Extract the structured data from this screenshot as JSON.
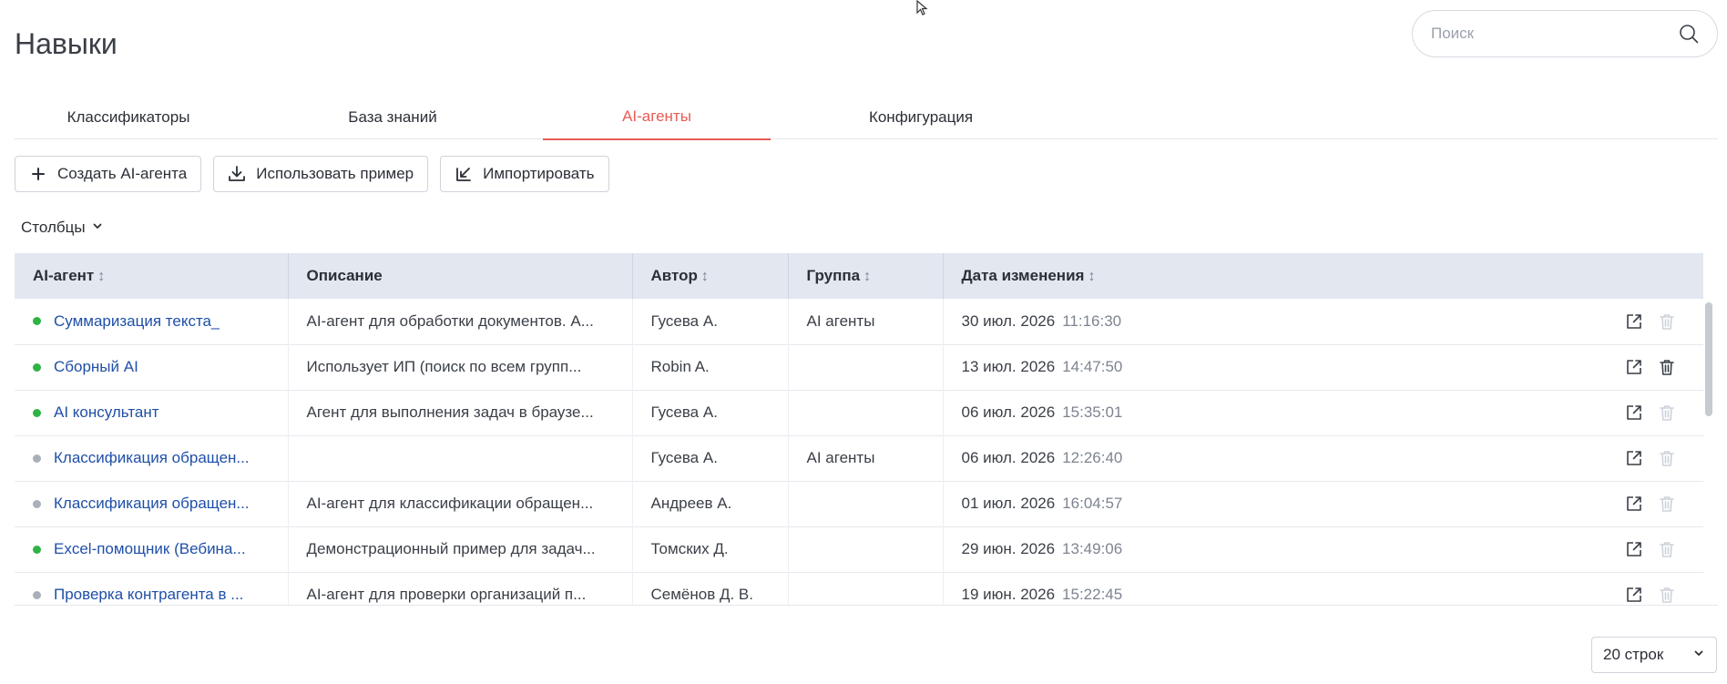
{
  "page": {
    "title": "Навыки"
  },
  "search": {
    "placeholder": "Поиск",
    "value": ""
  },
  "tabs": [
    {
      "label": "Классификаторы",
      "active": false
    },
    {
      "label": "База знаний",
      "active": false
    },
    {
      "label": "AI-агенты",
      "active": true
    },
    {
      "label": "Конфигурация",
      "active": false
    }
  ],
  "toolbar": {
    "create_label": "Создать AI-агента",
    "example_label": "Использовать пример",
    "import_label": "Импортировать"
  },
  "columns_toggle": {
    "label": "Столбцы"
  },
  "table": {
    "headers": {
      "agent": "AI-агент",
      "description": "Описание",
      "author": "Автор",
      "group": "Группа",
      "date": "Дата изменения"
    },
    "rows": [
      {
        "status": "active",
        "name": "Суммаризация текста_",
        "description": "AI-агент для обработки документов. А...",
        "author": "Гусева А.",
        "group": "AI агенты",
        "date": "30 июл. 2026",
        "time": "11:16:30",
        "delete_enabled": false
      },
      {
        "status": "active",
        "name": "Сборный AI",
        "description": "Использует ИП (поиск по всем групп...",
        "author": "Robin A.",
        "group": "",
        "date": "13 июл. 2026",
        "time": "14:47:50",
        "delete_enabled": true
      },
      {
        "status": "active",
        "name": "AI консультант",
        "description": "Агент для выполнения задач в браузе...",
        "author": "Гусева А.",
        "group": "",
        "date": "06 июл. 2026",
        "time": "15:35:01",
        "delete_enabled": false
      },
      {
        "status": "inactive",
        "name": "Классификация обращен...",
        "description": "",
        "author": "Гусева А.",
        "group": "AI агенты",
        "date": "06 июл. 2026",
        "time": "12:26:40",
        "delete_enabled": false
      },
      {
        "status": "inactive",
        "name": "Классификация обращен...",
        "description": "AI-агент для классификации обращен...",
        "author": "Андреев А.",
        "group": "",
        "date": "01 июл. 2026",
        "time": "16:04:57",
        "delete_enabled": false
      },
      {
        "status": "active",
        "name": "Excel-помощник (Вебина...",
        "description": "Демонстрационный пример для задач...",
        "author": "Томских Д.",
        "group": "",
        "date": "29 июн. 2026",
        "time": "13:49:06",
        "delete_enabled": false
      },
      {
        "status": "inactive",
        "name": "Проверка контрагента в ...",
        "description": "AI-агент для проверки организаций п...",
        "author": "Семёнов Д. В.",
        "group": "",
        "date": "19 июн. 2026",
        "time": "15:22:45",
        "delete_enabled": false
      }
    ]
  },
  "pagination": {
    "rows_label": "20 строк"
  },
  "colors": {
    "accent": "#e85b56",
    "link": "#1f4fa8",
    "status_active": "#2fb344",
    "status_inactive": "#a9b0bc",
    "header_bg": "#e2e7f0",
    "icon_enabled": "#3a3f47",
    "icon_disabled": "#cdd2da"
  }
}
